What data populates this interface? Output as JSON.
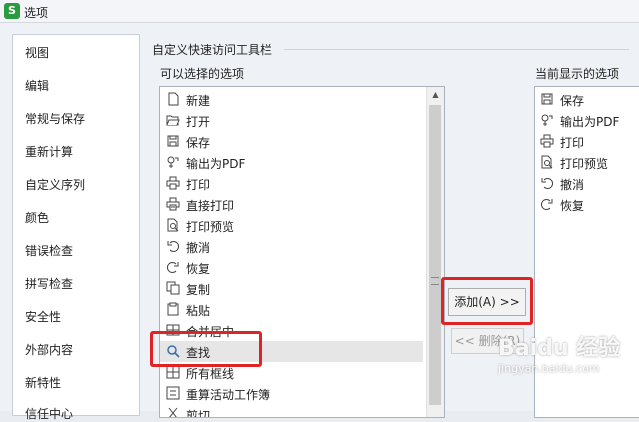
{
  "window": {
    "title": "选项",
    "app_icon": "S",
    "accent": "#2b9b3f"
  },
  "sidebar": {
    "items": [
      {
        "label": "视图"
      },
      {
        "label": "编辑"
      },
      {
        "label": "常规与保存"
      },
      {
        "label": "重新计算"
      },
      {
        "label": "自定义序列"
      },
      {
        "label": "颜色"
      },
      {
        "label": "错误检查"
      },
      {
        "label": "拼写检查"
      },
      {
        "label": "安全性"
      },
      {
        "label": "外部内容"
      },
      {
        "label": "新特性"
      },
      {
        "label": "信任中心"
      }
    ]
  },
  "main": {
    "section_title": "自定义快速访问工具栏",
    "available_label": "可以选择的选项",
    "current_label": "当前显示的选项",
    "available": [
      {
        "label": "新建",
        "icon": "new-document-icon"
      },
      {
        "label": "打开",
        "icon": "folder-open-icon"
      },
      {
        "label": "保存",
        "icon": "save-icon"
      },
      {
        "label": "输出为PDF",
        "icon": "pdf-export-icon"
      },
      {
        "label": "打印",
        "icon": "printer-icon"
      },
      {
        "label": "直接打印",
        "icon": "direct-print-icon"
      },
      {
        "label": "打印预览",
        "icon": "print-preview-icon"
      },
      {
        "label": "撤消",
        "icon": "undo-icon"
      },
      {
        "label": "恢复",
        "icon": "redo-icon"
      },
      {
        "label": "复制",
        "icon": "copy-icon"
      },
      {
        "label": "粘贴",
        "icon": "paste-icon"
      },
      {
        "label": "合并居中",
        "icon": "merge-center-icon"
      },
      {
        "label": "查找",
        "icon": "search-icon",
        "selected": true
      },
      {
        "label": "所有框线",
        "icon": "all-borders-icon"
      },
      {
        "label": "重算活动工作簿",
        "icon": "recalculate-icon"
      },
      {
        "label": "剪切",
        "icon": "cut-icon"
      }
    ],
    "current": [
      {
        "label": "保存",
        "icon": "save-icon"
      },
      {
        "label": "输出为PDF",
        "icon": "pdf-export-icon"
      },
      {
        "label": "打印",
        "icon": "printer-icon"
      },
      {
        "label": "打印预览",
        "icon": "print-preview-icon"
      },
      {
        "label": "撤消",
        "icon": "undo-icon"
      },
      {
        "label": "恢复",
        "icon": "redo-icon"
      }
    ],
    "add_button": "添加(A) >>",
    "remove_button": "<< 删除(R)"
  },
  "highlight_color": "#e02323",
  "watermark": {
    "line1": "Baidu 经验",
    "line2": "jingyan.baidu.com"
  }
}
